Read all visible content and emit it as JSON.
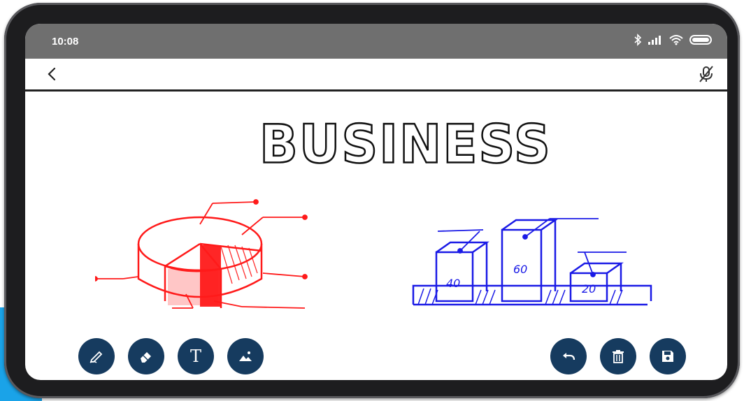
{
  "status": {
    "time": "10:08",
    "icons": [
      "bluetooth-icon",
      "signal-icon",
      "wifi-icon",
      "battery-icon"
    ]
  },
  "appbar": {
    "back_icon": "chevron-left-icon",
    "mic_icon": "mic-off-icon"
  },
  "canvas": {
    "title": "BUSINESS",
    "pie_sketch_color": "#ff1a1a",
    "bar_sketch_color": "#1a1ae6",
    "bar_values": [
      "40",
      "60",
      "20"
    ]
  },
  "tools_left": [
    {
      "icon": "pen-icon"
    },
    {
      "icon": "eraser-icon"
    },
    {
      "icon": "text-icon",
      "glyph": "T"
    },
    {
      "icon": "image-icon"
    }
  ],
  "tools_right": [
    {
      "icon": "undo-icon"
    },
    {
      "icon": "trash-icon"
    },
    {
      "icon": "save-icon"
    }
  ],
  "colors": {
    "tool_button": "#163b5f",
    "status_bar": "#6f6f6f",
    "accent_blue": "#1aa3e8"
  }
}
